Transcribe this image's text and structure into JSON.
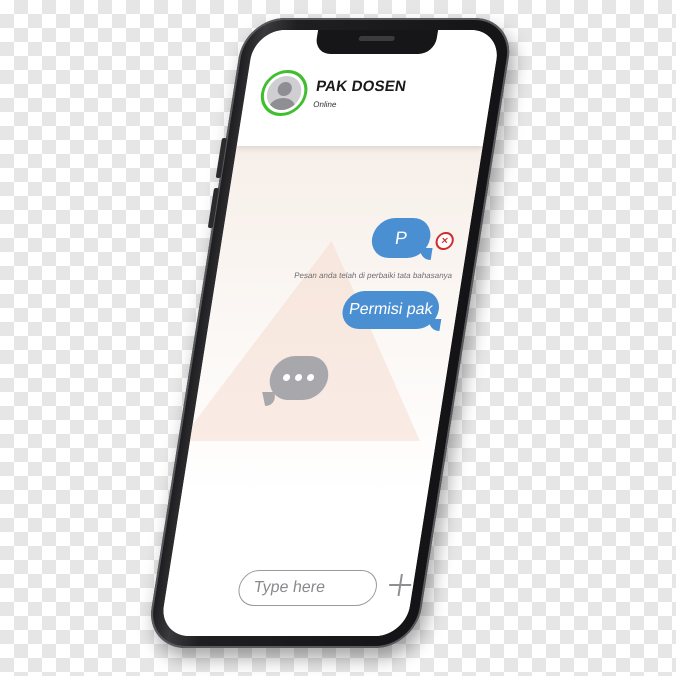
{
  "header": {
    "contact_name": "PAK DOSEN",
    "contact_status": "Online",
    "avatar_icon": "user-avatar-icon",
    "status_color": "#3fbf2e"
  },
  "messages": [
    {
      "sender": "me",
      "text": "P",
      "error": true,
      "error_icon": "x-circle-icon"
    },
    {
      "type": "system_note",
      "text": "Pesan anda telah di perbaiki tata bahasanya"
    },
    {
      "sender": "me",
      "text": "Permisi pak"
    },
    {
      "sender": "other",
      "typing": true,
      "indicator_icon": "typing-dots-icon"
    }
  ],
  "composer": {
    "placeholder": "Type here",
    "value": "",
    "add_icon": "plus-icon"
  },
  "colors": {
    "outgoing_bubble": "#4a8fd2",
    "incoming_bubble": "#a8a8ac",
    "error": "#d22b2b"
  }
}
